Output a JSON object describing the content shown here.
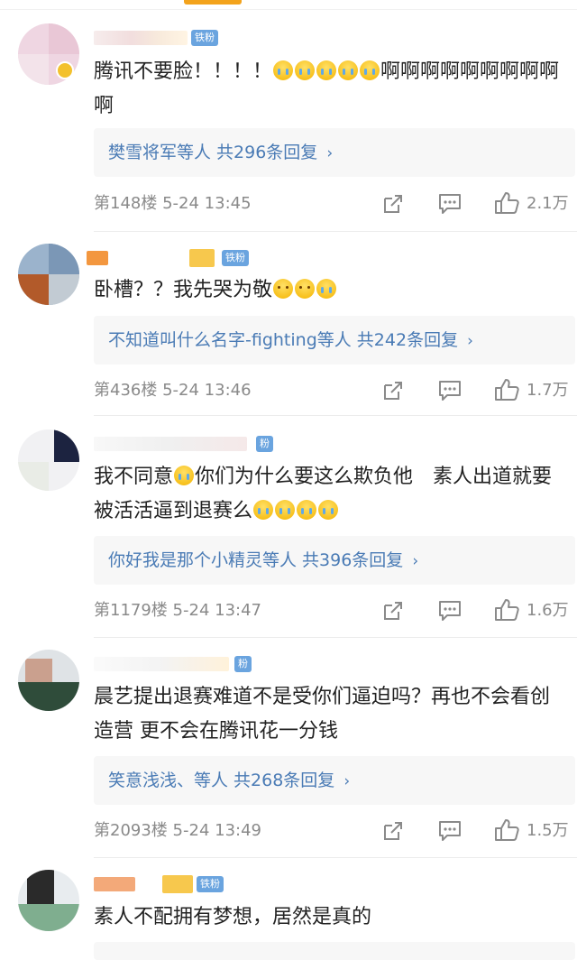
{
  "colors": {
    "accent": "#f3a31c",
    "link": "#4a7bb5",
    "badge": "#6aa4df",
    "meta": "#8a8a8a"
  },
  "icons": {
    "share": "share-icon",
    "reply": "comment-icon",
    "like": "thumbs-up-icon",
    "chevron": "chevron-right-icon"
  },
  "comments": [
    {
      "badge": "铁粉",
      "text_parts": [
        "腾讯不要脸！！！！",
        "啊啊啊啊啊啊啊啊啊啊"
      ],
      "emoji_count": 5,
      "replies": "樊雪将军等人 共296条回复",
      "floor": "第148楼",
      "time": "5-24 13:45",
      "likes": "2.1万"
    },
    {
      "badge": "铁粉",
      "text_parts": [
        "卧槽？？我先哭为敬"
      ],
      "emoji_count": 3,
      "replies": "不知道叫什么名字-fighting等人 共242条回复",
      "floor": "第436楼",
      "time": "5-24 13:46",
      "likes": "1.7万"
    },
    {
      "badge": "粉",
      "text_parts": [
        "我不同意",
        "你们为什么要这么欺负他　素人出道就要被活活逼到退赛么"
      ],
      "emoji_count": 4,
      "replies": "你好我是那个小精灵等人 共396条回复",
      "floor": "第1179楼",
      "time": "5-24 13:47",
      "likes": "1.6万"
    },
    {
      "badge": "粉",
      "text_parts": [
        "晨艺提出退赛难道不是受你们逼迫吗？再也不会看创造营 更不会在腾讯花一分钱"
      ],
      "emoji_count": 0,
      "replies": "笑意浅浅、等人 共268条回复",
      "floor": "第2093楼",
      "time": "5-24 13:49",
      "likes": "1.5万"
    },
    {
      "badge": "铁粉",
      "text_parts": [
        "素人不配拥有梦想，居然是真的"
      ],
      "emoji_count": 0,
      "replies": "",
      "floor": "",
      "time": "",
      "likes": ""
    }
  ]
}
